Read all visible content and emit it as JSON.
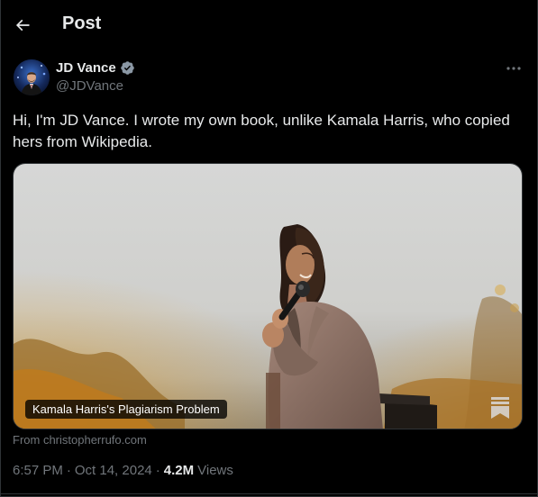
{
  "header": {
    "title": "Post",
    "back_icon": "arrow-left-icon"
  },
  "author": {
    "name": "JD Vance",
    "handle": "@JDVance",
    "verified_icon": "verified-badge-icon",
    "verified_color": "#8b98a5",
    "more_icon": "more-horizontal-icon"
  },
  "tweet": {
    "text": "Hi, I'm JD Vance. I wrote my own book, unlike Kamala Harris, who copied hers from Wikipedia."
  },
  "card": {
    "title": "Kamala Harris's Plagiarism Problem",
    "badge_icon": "substack-bookmark-icon",
    "source": "From christopherrufo.com"
  },
  "meta": {
    "time": "6:57 PM",
    "date": "Oct 14, 2024",
    "views_count": "4.2M",
    "views_label": "Views",
    "separator": "·"
  },
  "colors": {
    "background": "#000000",
    "text_primary": "#e7e9ea",
    "text_secondary": "#71767b",
    "border": "#2f3336"
  }
}
